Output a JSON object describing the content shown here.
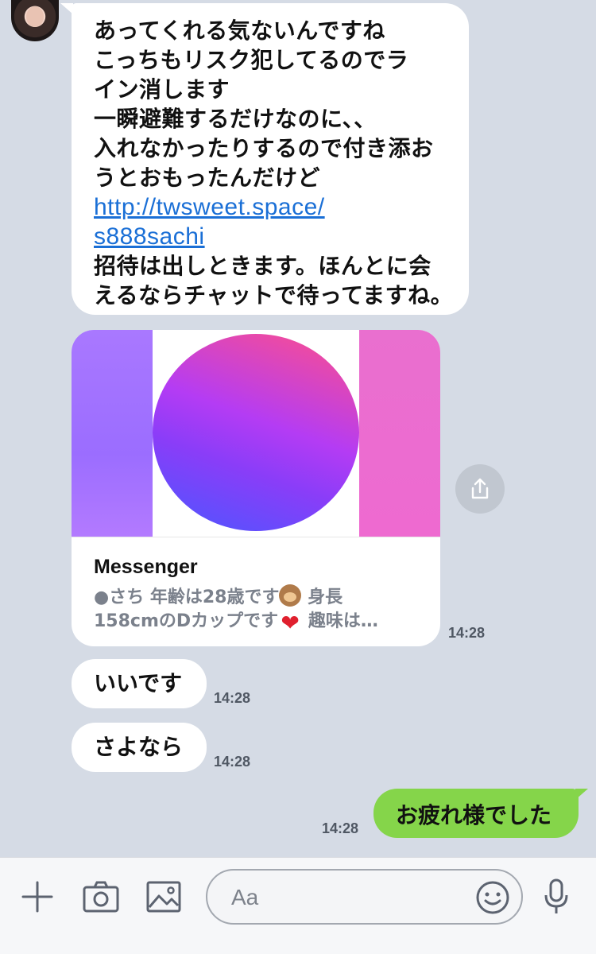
{
  "messages": {
    "first": {
      "lines": [
        "あってくれる気ないんですね",
        "こっちもリスク犯してるのでラ",
        "イン消します",
        "一瞬避難するだけなのに、、",
        "入れなかったりするので付き添お",
        "うとおもったんだけど"
      ],
      "link_line1": "http://twsweet.space/",
      "link_line2": "s888sachi",
      "after": [
        "招待は出しときます。ほんとに会",
        "えるならチャットで待ってますね。"
      ]
    },
    "card": {
      "title": "Messenger",
      "desc_line1_a": "●さち 年齢は28歳です",
      "desc_line1_b": " 身長",
      "desc_line2_a": "158cmのDカップです",
      "desc_line2_b": " 趣味は…",
      "time": "14:28"
    },
    "reply1": {
      "text": "いいです",
      "time": "14:28"
    },
    "reply2": {
      "text": "さよなら",
      "time": "14:28"
    },
    "sent": {
      "text": "お疲れ様でした",
      "time": "14:28"
    }
  },
  "input": {
    "placeholder": "Aa"
  },
  "icons": {
    "plus": "plus-icon",
    "camera": "camera-icon",
    "image": "image-icon",
    "emoji": "smiley-icon",
    "mic": "microphone-icon",
    "share": "share-icon"
  },
  "colors": {
    "sent_bubble": "#85d54a",
    "link": "#1a6fd6",
    "background": "#d5dbe5"
  }
}
